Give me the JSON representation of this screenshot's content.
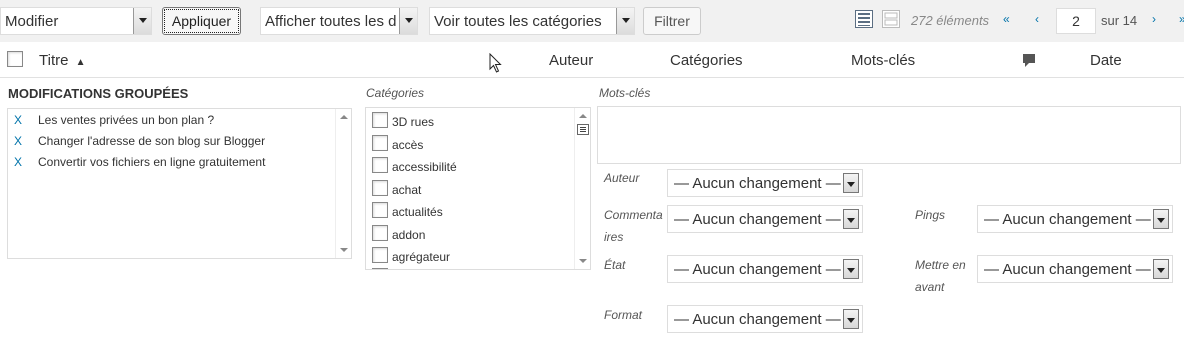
{
  "toolbar": {
    "bulk_action": "Modifier",
    "apply_label": "Appliquer",
    "date_filter": "Afficher toutes les d",
    "category_filter": "Voir toutes les catégories",
    "filter_label": "Filtrer",
    "items_count": "272 éléments",
    "first_page": "«",
    "prev_page": "‹",
    "current_page": "2",
    "total_pages": "sur 14",
    "next_page": "›",
    "last_page": "»"
  },
  "table_header": {
    "title": "Titre",
    "sort_indicator": "▲",
    "author": "Auteur",
    "categories": "Catégories",
    "tags": "Mots-clés",
    "comments_icon": "comment-bubble-icon",
    "date": "Date"
  },
  "bulk_edit": {
    "heading": "MODIFICATIONS GROUPÉES",
    "remove_marker": "X",
    "posts": [
      "Les ventes privées un bon plan ?",
      "Changer l'adresse de son blog sur Blogger",
      "Convertir vos fichiers en ligne gratuitement"
    ],
    "categories_label": "Catégories",
    "categories": [
      "3D rues",
      "accès",
      "accessibilité",
      "achat",
      "actualités",
      "addon",
      "agrégateur"
    ],
    "tags_label": "Mots-clés",
    "fields": {
      "author_label": "Auteur",
      "author_value": "— Aucun changement —",
      "comments_label_1": "Commenta",
      "comments_label_2": "ires",
      "comments_value": "— Aucun changement —",
      "status_label": "État",
      "status_value": "— Aucun changement —",
      "format_label": "Format",
      "format_value": "— Aucun changement —",
      "pings_label": "Pings",
      "pings_value": "— Aucun changement —",
      "sticky_label_1": "Mettre en",
      "sticky_label_2": "avant",
      "sticky_value": "— Aucun changement —"
    }
  },
  "colors": {
    "link": "#0073aa",
    "toolbar_bg": "#f1f1f1",
    "border": "#dddddd"
  }
}
